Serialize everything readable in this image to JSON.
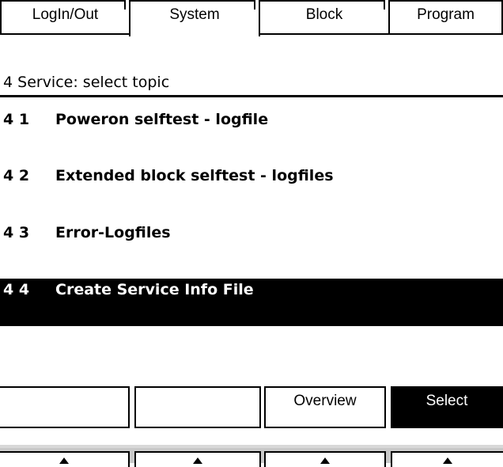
{
  "tabs": [
    {
      "label": "LogIn/Out",
      "active": false
    },
    {
      "label": "System",
      "active": true
    },
    {
      "label": "Block",
      "active": false
    },
    {
      "label": "Program",
      "active": false
    }
  ],
  "section_title": "4 Service: select topic",
  "menu_items": [
    {
      "number": "4 1",
      "label": "Poweron selftest - logfile",
      "selected": false
    },
    {
      "number": "4 2",
      "label": "Extended block selftest - logfiles",
      "selected": false
    },
    {
      "number": "4 3",
      "label": "Error-Logfiles",
      "selected": false
    },
    {
      "number": "4 4",
      "label": "Create Service Info File",
      "selected": true
    }
  ],
  "softkeys": [
    {
      "label": "",
      "highlighted": false
    },
    {
      "label": "",
      "highlighted": false
    },
    {
      "label": "Overview",
      "highlighted": false
    },
    {
      "label": "Select",
      "highlighted": true
    }
  ],
  "hardware_keys": [
    {
      "icon": "up-arrow-icon"
    },
    {
      "icon": "up-arrow-icon"
    },
    {
      "icon": "up-arrow-icon"
    },
    {
      "icon": "up-arrow-icon"
    }
  ],
  "colors": {
    "background": "#ffffff",
    "foreground": "#000000",
    "highlight_background": "#000000",
    "highlight_foreground": "#ffffff",
    "keystrip": "#c8c8c8"
  }
}
